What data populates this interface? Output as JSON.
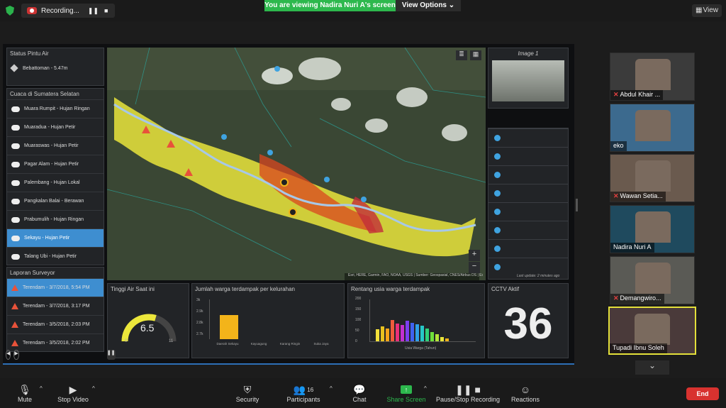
{
  "recording": {
    "label": "Recording..."
  },
  "banner": {
    "viewing": "You are viewing Nadira Nuri A's screen",
    "view_options": "View Options"
  },
  "view_button": "View",
  "dashboard": {
    "status_pintu_air": {
      "title": "Status Pintu Air",
      "item": "Bebattoman - 5.47m"
    },
    "cuaca": {
      "title": "Cuaca di Sumatera Selatan",
      "items": [
        "Muara Rumpit - Hujan Ringan",
        "Muaradua - Hujan Petir",
        "Muaraswas - Hujan Petir",
        "Pagar Alam - Hujan Petir",
        "Palembang - Hujan Lokal",
        "Pangkalan Balai - Berawan",
        "Prabumulih - Hujan Ringan",
        "Sekayu - Hujan Petir",
        "Talang Ubi - Hujan Petir"
      ],
      "selected": 7
    },
    "laporan": {
      "title": "Laporan Surveyor",
      "items": [
        "Terendam - 3/7/2018, 5:54 PM",
        "Terendam - 3/7/2018, 3:17 PM",
        "Terendam - 3/5/2018, 2:03 PM",
        "Terendam - 3/5/2018, 2:02 PM"
      ]
    },
    "map": {
      "attribution": "Esri, HERE, Garmin, FAO, NOAA, USGS | Sumber: Geospasial, CNES/Airbus DS | Esri, HERE, Garmin"
    },
    "image_panel": {
      "title": "Image 1"
    },
    "last_update": "Last update: 2 minutes ago",
    "tinggi_air": {
      "title": "Tinggi Air Saat ini",
      "value": "6.5",
      "min": "0",
      "max": "11",
      "fraction": 0.59
    },
    "jumlah_warga": {
      "title": "Jumlah warga terdampak per kelurahan",
      "yticks": [
        "3k",
        "2.9k",
        "2.8k",
        "2.7k"
      ],
      "xlabels": [
        "Daerah Sekayu",
        "Kayuagung",
        "Karang Ringin",
        "Suka Jaya"
      ]
    },
    "rentang_usia": {
      "title": "Rentang usia warga terdampak",
      "yticks": [
        "200",
        "150",
        "100",
        "50",
        "0"
      ],
      "xlabel": "Usia Warga (Tahun)"
    },
    "cctv": {
      "title": "CCTV Aktif",
      "value": "36"
    }
  },
  "participants": [
    {
      "name": "Abdul Khair ...",
      "muted": true
    },
    {
      "name": "eko",
      "muted": false
    },
    {
      "name": "Wawan Setia...",
      "muted": true
    },
    {
      "name": "Nadira Nuri A",
      "muted": false
    },
    {
      "name": "Demangwiro...",
      "muted": true
    },
    {
      "name": "Tupadi Ibnu Soleh",
      "muted": false
    }
  ],
  "toolbar": {
    "mute": "Mute",
    "stop_video": "Stop Video",
    "security": "Security",
    "participants": "Participants",
    "participants_count": "16",
    "chat": "Chat",
    "share_screen": "Share Screen",
    "pause_stop_recording": "Pause/Stop Recording",
    "reactions": "Reactions",
    "end": "End"
  },
  "colors": {
    "accent_green": "#2db84d",
    "selected_blue": "#3e8ed0",
    "end_red": "#d8322f",
    "speaker_border": "#e3e03a"
  }
}
